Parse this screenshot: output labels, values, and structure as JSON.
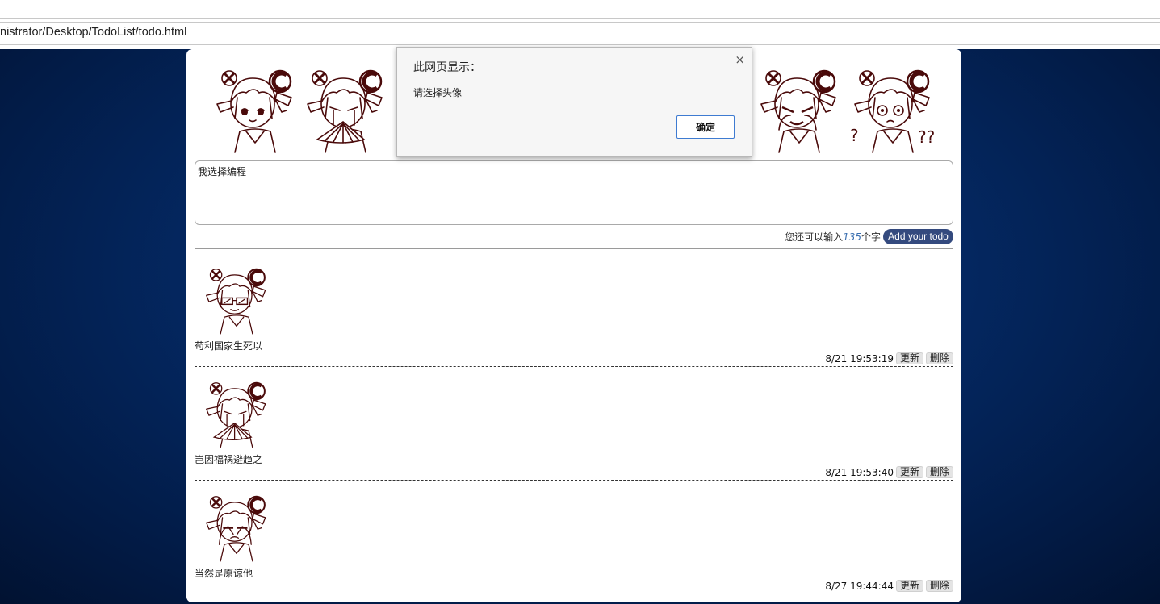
{
  "browser": {
    "url": "nistrator/Desktop/TodoList/todo.html"
  },
  "avatars": {
    "options": [
      "smile-avatar",
      "cry-fan-avatar",
      "glasses-avatar",
      "cover-eyes-avatar",
      "cry-face-avatar",
      "confused-avatar"
    ]
  },
  "composer": {
    "input_value": "我选择编程",
    "counter_prefix": "您还可以输入",
    "counter_number": "135",
    "counter_suffix": "个字",
    "add_label": "Add your todo"
  },
  "todos": [
    {
      "text": "苟利国家生死以",
      "time": "8/21 19:53:19",
      "update_label": "更新",
      "delete_label": "删除"
    },
    {
      "text": "岂因福祸避趋之",
      "time": "8/21 19:53:40",
      "update_label": "更新",
      "delete_label": "删除"
    },
    {
      "text": "当然是原谅他",
      "time": "8/27 19:44:44",
      "update_label": "更新",
      "delete_label": "删除"
    }
  ],
  "dialog": {
    "title": "此网页显示：",
    "message": "请选择头像",
    "ok_label": "确定",
    "close_glyph": "×"
  },
  "colors": {
    "background": "#042a66",
    "add_button": "#344a7e",
    "avatar_ink": "#4a0a0a"
  }
}
